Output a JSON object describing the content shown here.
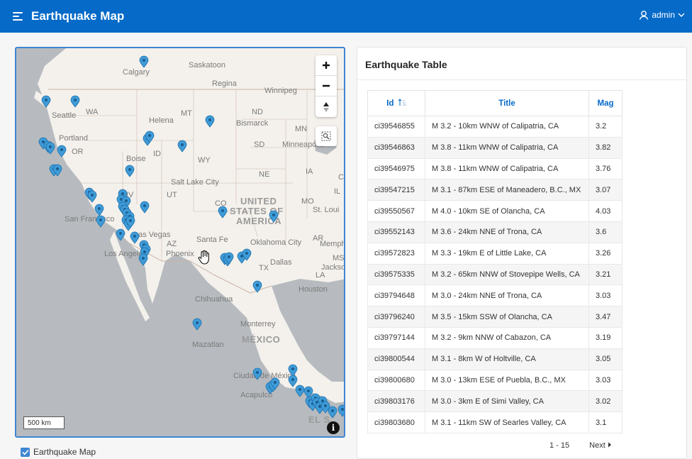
{
  "header": {
    "app_title": "Earthquake Map",
    "user": "admin",
    "brand_color": "#056ac8"
  },
  "map": {
    "labels": {
      "calgary": "Calgary",
      "saskatoon": "Saskatoon",
      "regina": "Regina",
      "winnipeg": "Winnipeg",
      "seattle": "Seattle",
      "wa": "WA",
      "portland": "Portland",
      "or": "OR",
      "helena": "Helena",
      "mt": "MT",
      "nd": "ND",
      "bismarck": "Bismarck",
      "mn": "MN",
      "minneapolis": "Minneapolis",
      "sd": "SD",
      "boise": "Boise",
      "id": "ID",
      "wy": "WY",
      "ne": "NE",
      "ia": "IA",
      "salt_lake": "Salt Lake City",
      "nv": "NV",
      "ut": "UT",
      "co": "CO",
      "united": "UNITED",
      "states_of": "STATES OF",
      "america": "AMERICA",
      "mo": "MO",
      "st_louis": "St. Loui",
      "il": "IL",
      "san_francisco": "San Francisco",
      "las_vegas": "Las Vegas",
      "santa_fe": "Santa Fe",
      "oklahoma_city": "Oklahoma City",
      "ar": "AR",
      "memphis": "Memph",
      "az": "AZ",
      "phoenix": "Phoenix",
      "los_angeles": "Los Angeles",
      "ms": "MS",
      "tx": "TX",
      "dallas": "Dallas",
      "jackson": "Jackso",
      "la": "LA",
      "houston": "Houston",
      "chihuahua": "Chihuahua",
      "monterrey": "Monterrey",
      "mexico": "MÉXICO",
      "mazatlan": "Mazatlan",
      "ciudad_mexico": "Ciudad de México",
      "acapulco": "Acapulco",
      "el_s": "EL S",
      "c_label": "C"
    },
    "scale_label": "500 km",
    "info_icon": "info-icon",
    "zoom_in_icon": "plus-icon",
    "zoom_out_icon": "minus-icon",
    "compass_icon": "compass-icon",
    "extent_icon": "zoom-extent-icon",
    "marker_color": "#3f9bd8",
    "layer_toggle_label": "Earthquake Map"
  },
  "table": {
    "title": "Earthquake Table",
    "columns": {
      "id": "Id",
      "title": "Title",
      "mag": "Mag"
    },
    "sort_icon": "sort-ascending-icon",
    "rows": [
      {
        "id": "ci39546855",
        "title": "M 3.2 - 10km WNW of Calipatria, CA",
        "mag": "3.2"
      },
      {
        "id": "ci39546863",
        "title": "M 3.8 - 11km WNW of Calipatria, CA",
        "mag": "3.82"
      },
      {
        "id": "ci39546975",
        "title": "M 3.8 - 11km WNW of Calipatria, CA",
        "mag": "3.76"
      },
      {
        "id": "ci39547215",
        "title": "M 3.1 - 87km ESE of Maneadero, B.C., MX",
        "mag": "3.07"
      },
      {
        "id": "ci39550567",
        "title": "M 4.0 - 10km SE of Olancha, CA",
        "mag": "4.03"
      },
      {
        "id": "ci39552143",
        "title": "M 3.6 - 24km NNE of Trona, CA",
        "mag": "3.6"
      },
      {
        "id": "ci39572823",
        "title": "M 3.3 - 19km E of Little Lake, CA",
        "mag": "3.26"
      },
      {
        "id": "ci39575335",
        "title": "M 3.2 - 65km NNW of Stovepipe Wells, CA",
        "mag": "3.21"
      },
      {
        "id": "ci39794648",
        "title": "M 3.0 - 24km NNE of Trona, CA",
        "mag": "3.03"
      },
      {
        "id": "ci39796240",
        "title": "M 3.5 - 15km SSW of Olancha, CA",
        "mag": "3.47"
      },
      {
        "id": "ci39797144",
        "title": "M 3.2 - 9km NNW of Cabazon, CA",
        "mag": "3.19"
      },
      {
        "id": "ci39800544",
        "title": "M 3.1 - 8km W of Holtville, CA",
        "mag": "3.05"
      },
      {
        "id": "ci39800680",
        "title": "M 3.0 - 13km ESE of Puebla, B.C., MX",
        "mag": "3.03"
      },
      {
        "id": "ci39803176",
        "title": "M 3.0 - 3km E of Simi Valley, CA",
        "mag": "3.02"
      },
      {
        "id": "ci39803680",
        "title": "M 3.1 - 11km SW of Searles Valley, CA",
        "mag": "3.1"
      }
    ],
    "pagination": {
      "range": "1 - 15",
      "next": "Next"
    }
  }
}
